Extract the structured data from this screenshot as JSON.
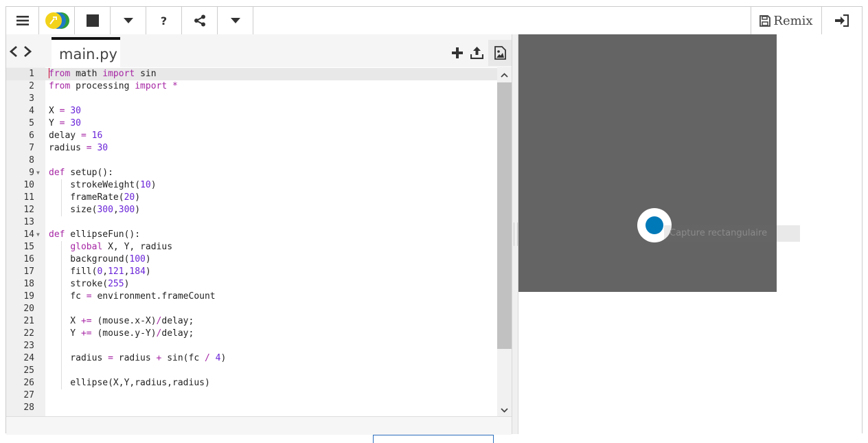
{
  "toolbar": {
    "remix_label": "Remix",
    "buttons": [
      "menu-icon",
      "logo",
      "stop-icon",
      "chevron-down-icon",
      "help-icon",
      "share-icon",
      "chevron-down-icon"
    ],
    "help_glyph": "?"
  },
  "tabbar": {
    "file_name": "main.py"
  },
  "editor": {
    "lines": [
      "from math import sin",
      "from processing import *",
      "",
      "X = 30",
      "Y = 30",
      "delay = 16",
      "radius = 30",
      "",
      "def setup():",
      "    strokeWeight(10)",
      "    frameRate(20)",
      "    size(300,300)",
      "",
      "def ellipseFun():",
      "    global X, Y, radius",
      "    background(100)",
      "    fill(0,121,184)",
      "    stroke(255)",
      "    fc = environment.frameCount",
      "",
      "    X += (mouse.x-X)/delay;",
      "    Y += (mouse.y-Y)/delay;",
      "",
      "    radius = radius + sin(fc / 4)",
      "",
      "    ellipse(X,Y,radius,radius)",
      "",
      ""
    ]
  },
  "output": {
    "overlay_text": "Capture rectangulaire"
  },
  "colors": {
    "canvas_bg": "#646464",
    "ellipse_fill": "#0079b8",
    "ellipse_stroke": "#ffffff",
    "keyword": "#a626a4",
    "number": "#6a24d8"
  }
}
